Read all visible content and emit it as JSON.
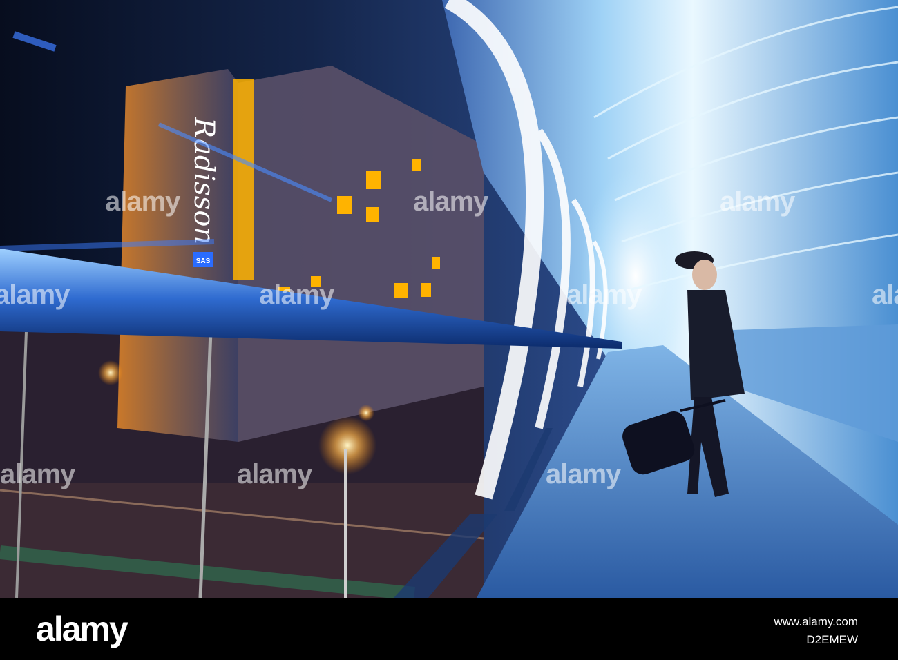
{
  "photo": {
    "hotel_sign": "Radisson",
    "hotel_logo": "SAS"
  },
  "watermark": {
    "text": "alamy"
  },
  "footer": {
    "logo": "alamy",
    "meta_line_1": "www.alamy.com",
    "meta_line_2": "D2EMEW"
  },
  "colors": {
    "footer_background": "#000000",
    "window_light": "#ffb300",
    "tunnel_glow": "#bfe8ff"
  }
}
